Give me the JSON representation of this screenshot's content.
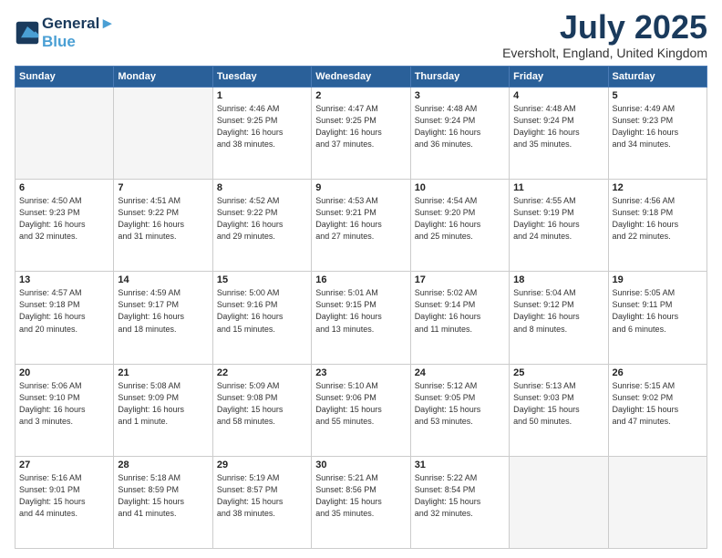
{
  "header": {
    "logo_line1": "General",
    "logo_line2": "Blue",
    "title": "July 2025",
    "subtitle": "Eversholt, England, United Kingdom"
  },
  "weekdays": [
    "Sunday",
    "Monday",
    "Tuesday",
    "Wednesday",
    "Thursday",
    "Friday",
    "Saturday"
  ],
  "weeks": [
    [
      {
        "day": "",
        "info": ""
      },
      {
        "day": "",
        "info": ""
      },
      {
        "day": "1",
        "info": "Sunrise: 4:46 AM\nSunset: 9:25 PM\nDaylight: 16 hours\nand 38 minutes."
      },
      {
        "day": "2",
        "info": "Sunrise: 4:47 AM\nSunset: 9:25 PM\nDaylight: 16 hours\nand 37 minutes."
      },
      {
        "day": "3",
        "info": "Sunrise: 4:48 AM\nSunset: 9:24 PM\nDaylight: 16 hours\nand 36 minutes."
      },
      {
        "day": "4",
        "info": "Sunrise: 4:48 AM\nSunset: 9:24 PM\nDaylight: 16 hours\nand 35 minutes."
      },
      {
        "day": "5",
        "info": "Sunrise: 4:49 AM\nSunset: 9:23 PM\nDaylight: 16 hours\nand 34 minutes."
      }
    ],
    [
      {
        "day": "6",
        "info": "Sunrise: 4:50 AM\nSunset: 9:23 PM\nDaylight: 16 hours\nand 32 minutes."
      },
      {
        "day": "7",
        "info": "Sunrise: 4:51 AM\nSunset: 9:22 PM\nDaylight: 16 hours\nand 31 minutes."
      },
      {
        "day": "8",
        "info": "Sunrise: 4:52 AM\nSunset: 9:22 PM\nDaylight: 16 hours\nand 29 minutes."
      },
      {
        "day": "9",
        "info": "Sunrise: 4:53 AM\nSunset: 9:21 PM\nDaylight: 16 hours\nand 27 minutes."
      },
      {
        "day": "10",
        "info": "Sunrise: 4:54 AM\nSunset: 9:20 PM\nDaylight: 16 hours\nand 25 minutes."
      },
      {
        "day": "11",
        "info": "Sunrise: 4:55 AM\nSunset: 9:19 PM\nDaylight: 16 hours\nand 24 minutes."
      },
      {
        "day": "12",
        "info": "Sunrise: 4:56 AM\nSunset: 9:18 PM\nDaylight: 16 hours\nand 22 minutes."
      }
    ],
    [
      {
        "day": "13",
        "info": "Sunrise: 4:57 AM\nSunset: 9:18 PM\nDaylight: 16 hours\nand 20 minutes."
      },
      {
        "day": "14",
        "info": "Sunrise: 4:59 AM\nSunset: 9:17 PM\nDaylight: 16 hours\nand 18 minutes."
      },
      {
        "day": "15",
        "info": "Sunrise: 5:00 AM\nSunset: 9:16 PM\nDaylight: 16 hours\nand 15 minutes."
      },
      {
        "day": "16",
        "info": "Sunrise: 5:01 AM\nSunset: 9:15 PM\nDaylight: 16 hours\nand 13 minutes."
      },
      {
        "day": "17",
        "info": "Sunrise: 5:02 AM\nSunset: 9:14 PM\nDaylight: 16 hours\nand 11 minutes."
      },
      {
        "day": "18",
        "info": "Sunrise: 5:04 AM\nSunset: 9:12 PM\nDaylight: 16 hours\nand 8 minutes."
      },
      {
        "day": "19",
        "info": "Sunrise: 5:05 AM\nSunset: 9:11 PM\nDaylight: 16 hours\nand 6 minutes."
      }
    ],
    [
      {
        "day": "20",
        "info": "Sunrise: 5:06 AM\nSunset: 9:10 PM\nDaylight: 16 hours\nand 3 minutes."
      },
      {
        "day": "21",
        "info": "Sunrise: 5:08 AM\nSunset: 9:09 PM\nDaylight: 16 hours\nand 1 minute."
      },
      {
        "day": "22",
        "info": "Sunrise: 5:09 AM\nSunset: 9:08 PM\nDaylight: 15 hours\nand 58 minutes."
      },
      {
        "day": "23",
        "info": "Sunrise: 5:10 AM\nSunset: 9:06 PM\nDaylight: 15 hours\nand 55 minutes."
      },
      {
        "day": "24",
        "info": "Sunrise: 5:12 AM\nSunset: 9:05 PM\nDaylight: 15 hours\nand 53 minutes."
      },
      {
        "day": "25",
        "info": "Sunrise: 5:13 AM\nSunset: 9:03 PM\nDaylight: 15 hours\nand 50 minutes."
      },
      {
        "day": "26",
        "info": "Sunrise: 5:15 AM\nSunset: 9:02 PM\nDaylight: 15 hours\nand 47 minutes."
      }
    ],
    [
      {
        "day": "27",
        "info": "Sunrise: 5:16 AM\nSunset: 9:01 PM\nDaylight: 15 hours\nand 44 minutes."
      },
      {
        "day": "28",
        "info": "Sunrise: 5:18 AM\nSunset: 8:59 PM\nDaylight: 15 hours\nand 41 minutes."
      },
      {
        "day": "29",
        "info": "Sunrise: 5:19 AM\nSunset: 8:57 PM\nDaylight: 15 hours\nand 38 minutes."
      },
      {
        "day": "30",
        "info": "Sunrise: 5:21 AM\nSunset: 8:56 PM\nDaylight: 15 hours\nand 35 minutes."
      },
      {
        "day": "31",
        "info": "Sunrise: 5:22 AM\nSunset: 8:54 PM\nDaylight: 15 hours\nand 32 minutes."
      },
      {
        "day": "",
        "info": ""
      },
      {
        "day": "",
        "info": ""
      }
    ]
  ]
}
